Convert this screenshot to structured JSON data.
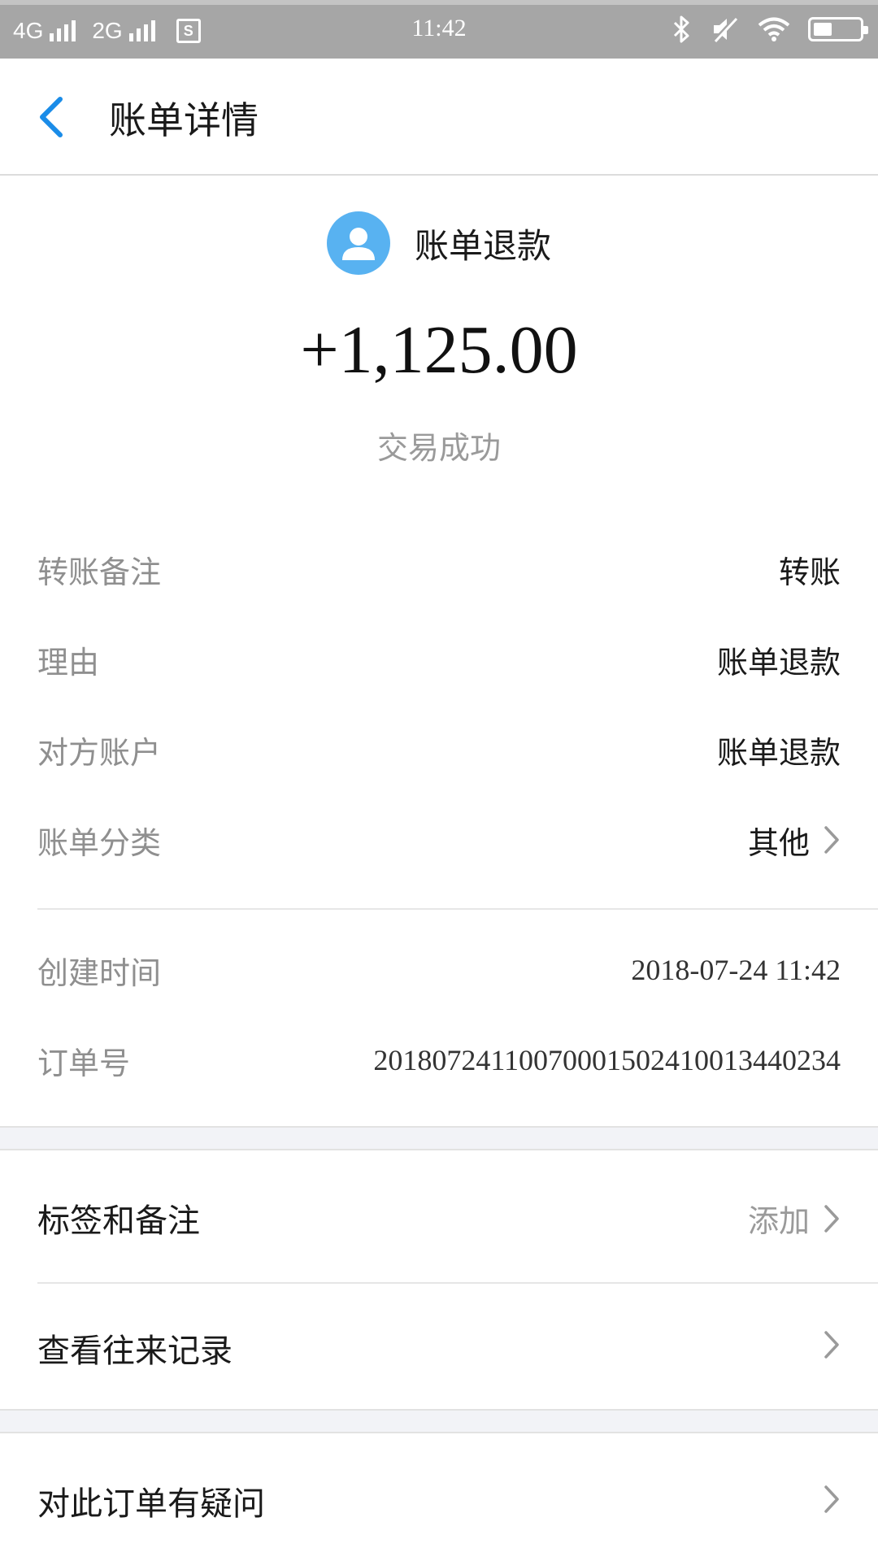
{
  "status_bar": {
    "net1": "4G",
    "net2": "2G",
    "sim_badge": "S",
    "time": "11:42",
    "icons": [
      "signal-icon",
      "sim-icon",
      "bluetooth-icon",
      "mute-icon",
      "wifi-icon",
      "battery-icon"
    ]
  },
  "nav": {
    "title": "账单详情",
    "back_icon": "chevron-left-icon",
    "accent": "#1a8ce8"
  },
  "header": {
    "payee": "账单退款",
    "amount": "+1,125.00",
    "status": "交易成功",
    "avatar_color": "#58b2f1"
  },
  "details": [
    {
      "label": "转账备注",
      "value": "转账"
    },
    {
      "label": "理由",
      "value": "账单退款"
    },
    {
      "label": "对方账户",
      "value": "账单退款"
    },
    {
      "label": "账单分类",
      "value": "其他"
    }
  ],
  "meta": [
    {
      "label": "创建时间",
      "value": "2018-07-24 11:42"
    },
    {
      "label": "订单号",
      "value": "20180724110070001502410013440234"
    }
  ],
  "actions": {
    "tags": {
      "label": "标签和备注",
      "hint": "添加"
    },
    "records": {
      "label": "查看往来记录"
    },
    "question": {
      "label": "对此订单有疑问"
    }
  }
}
